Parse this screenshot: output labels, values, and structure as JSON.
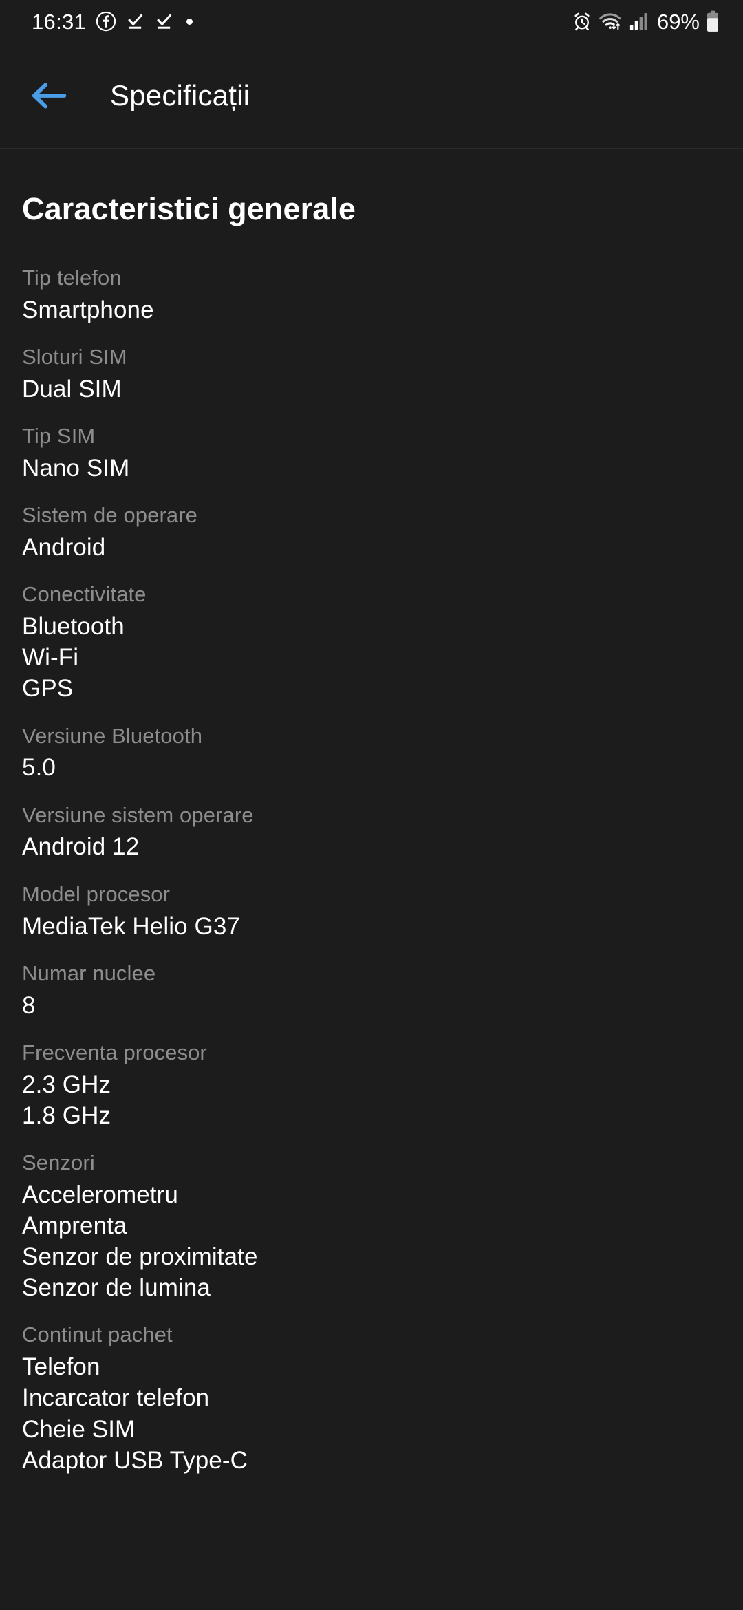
{
  "status_bar": {
    "time": "16:31",
    "left_icons": [
      {
        "name": "facebook-icon",
        "label": "f"
      },
      {
        "name": "download-complete-icon",
        "label": ""
      },
      {
        "name": "download-complete-icon",
        "label": ""
      },
      {
        "name": "notification-dot-icon",
        "label": ""
      }
    ],
    "right_icons": [
      {
        "name": "alarm-icon"
      },
      {
        "name": "wifi-data-icon"
      },
      {
        "name": "signal-bars-icon"
      }
    ],
    "battery_percent": "69%"
  },
  "app_bar": {
    "back_label": "back-arrow",
    "title": "Specificații",
    "accent_color": "#4a9ee8"
  },
  "main": {
    "section_title": "Caracteristici generale",
    "specs": [
      {
        "label": "Tip telefon",
        "values": [
          "Smartphone"
        ]
      },
      {
        "label": "Sloturi SIM",
        "values": [
          "Dual SIM"
        ]
      },
      {
        "label": "Tip SIM",
        "values": [
          "Nano SIM"
        ]
      },
      {
        "label": "Sistem de operare",
        "values": [
          "Android"
        ]
      },
      {
        "label": "Conectivitate",
        "values": [
          "Bluetooth",
          "Wi-Fi",
          "GPS"
        ]
      },
      {
        "label": "Versiune Bluetooth",
        "values": [
          "5.0"
        ]
      },
      {
        "label": "Versiune sistem operare",
        "values": [
          "Android 12"
        ]
      },
      {
        "label": "Model procesor",
        "values": [
          "MediaTek Helio G37"
        ]
      },
      {
        "label": "Numar nuclee",
        "values": [
          "8"
        ]
      },
      {
        "label": "Frecventa procesor",
        "values": [
          "2.3 GHz",
          "1.8 GHz"
        ]
      },
      {
        "label": "Senzori",
        "values": [
          "Accelerometru",
          "Amprenta",
          "Senzor de proximitate",
          "Senzor de lumina"
        ]
      },
      {
        "label": "Continut pachet",
        "values": [
          "Telefon",
          "Incarcator telefon",
          "Cheie SIM",
          "Adaptor USB Type-C"
        ]
      }
    ]
  },
  "colors": {
    "background": "#1c1c1c",
    "label_gray": "#8d8d8d",
    "value_white": "#ffffff",
    "accent_blue": "#4a9ee8"
  }
}
